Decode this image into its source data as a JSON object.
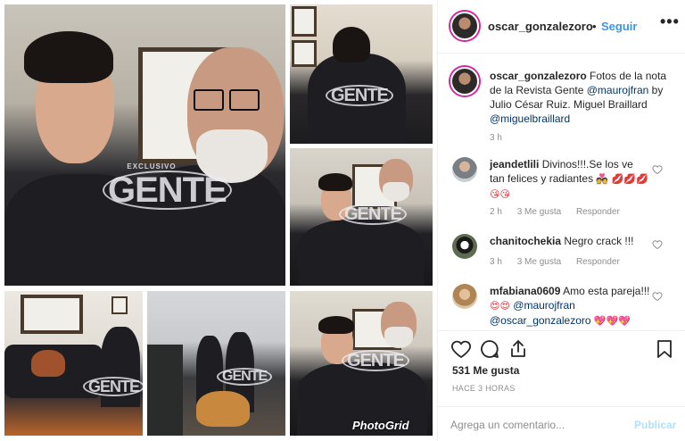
{
  "post": {
    "username": "oscar_gonzalezoro",
    "dot": "•",
    "follow_label": "Seguir",
    "more_label": "•••"
  },
  "caption": {
    "username": "oscar_gonzalezoro",
    "text_1": "Fotos de la nota de la Revista Gente",
    "mention_1": "@maurojfran",
    "text_2": "by Julio César Ruiz. Miguel Braillard",
    "mention_2": "@miguelbraillard",
    "time": "3 h"
  },
  "comments": [
    {
      "username": "jeandetlili",
      "text": "Divinos!!!.Se los ve tan felices y radiantes",
      "emoji": "💑 💋💋💋 😘😘",
      "time": "2 h",
      "likes": "3 Me gusta",
      "reply_label": "Responder"
    },
    {
      "username": "chanitochekia",
      "text": "Negro crack !!!",
      "time": "3 h",
      "likes": "3 Me gusta",
      "reply_label": "Responder"
    },
    {
      "username": "mfabiana0609",
      "text": "Amo esta pareja!!!",
      "emoji_1": "😍😍",
      "mention_1": "@maurojfran",
      "mention_2": "@oscar_gonzalezoro",
      "emoji_2": "💖💖💖"
    }
  ],
  "footer": {
    "likes_count": "531 Me gusta",
    "time_ago": "HACE 3 HORAS",
    "comment_placeholder": "Agrega un comentario...",
    "post_label": "Publicar"
  },
  "photo": {
    "watermark_small": "EXCLUSIVO",
    "watermark": "GENTE",
    "photogrid_label": "PhotoGrid"
  },
  "colors": {
    "link_blue": "#3897f0",
    "mention_navy": "#003569",
    "muted_gray": "#8e8e8e",
    "post_disabled": "#b2dffc",
    "story_ring": "#d6249f"
  }
}
